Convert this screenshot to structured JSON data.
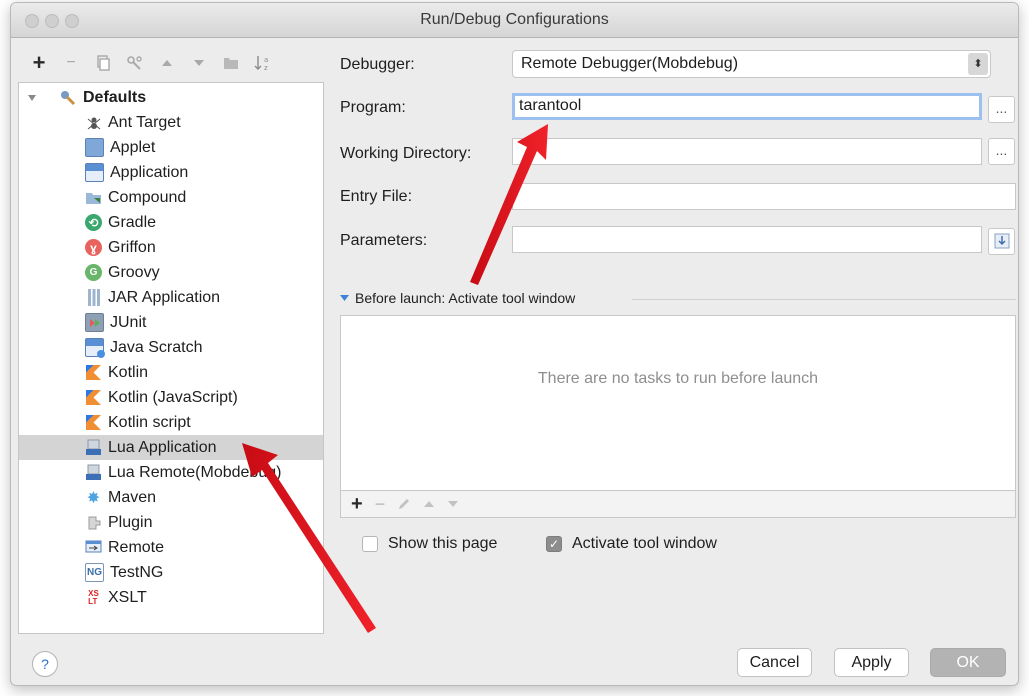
{
  "window": {
    "title": "Run/Debug Configurations"
  },
  "left_toolbar": {
    "icons": [
      "plus-icon",
      "minus-icon",
      "copy-icon",
      "wrench-icon",
      "arrow-up-icon",
      "arrow-down-icon",
      "folder-icon",
      "sort-icon"
    ],
    "add_glyph": "+",
    "remove_glyph": "−"
  },
  "tree": {
    "root_label": "Defaults",
    "items": [
      {
        "label": "Ant Target",
        "icon": "ant-icon"
      },
      {
        "label": "Applet",
        "icon": "applet-icon"
      },
      {
        "label": "Application",
        "icon": "application-icon"
      },
      {
        "label": "Compound",
        "icon": "compound-icon"
      },
      {
        "label": "Gradle",
        "icon": "gradle-icon"
      },
      {
        "label": "Griffon",
        "icon": "griffon-icon"
      },
      {
        "label": "Groovy",
        "icon": "groovy-icon"
      },
      {
        "label": "JAR Application",
        "icon": "jar-icon"
      },
      {
        "label": "JUnit",
        "icon": "junit-icon"
      },
      {
        "label": "Java Scratch",
        "icon": "java-scratch-icon"
      },
      {
        "label": "Kotlin",
        "icon": "kotlin-icon"
      },
      {
        "label": "Kotlin (JavaScript)",
        "icon": "kotlin-icon"
      },
      {
        "label": "Kotlin script",
        "icon": "kotlin-icon"
      },
      {
        "label": "Lua Application",
        "icon": "lua-icon",
        "selected": true
      },
      {
        "label": "Lua Remote(Mobdebug)",
        "icon": "lua-icon"
      },
      {
        "label": "Maven",
        "icon": "maven-icon"
      },
      {
        "label": "Plugin",
        "icon": "plugin-icon"
      },
      {
        "label": "Remote",
        "icon": "remote-icon"
      },
      {
        "label": "TestNG",
        "icon": "testng-icon"
      },
      {
        "label": "XSLT",
        "icon": "xslt-icon"
      }
    ]
  },
  "form": {
    "debugger_label": "Debugger:",
    "debugger_value": "Remote Debugger(Mobdebug)",
    "program_label": "Program:",
    "program_value": "tarantool",
    "working_dir_label": "Working Directory:",
    "working_dir_value": "",
    "entry_file_label": "Entry File:",
    "entry_file_value": "",
    "parameters_label": "Parameters:",
    "parameters_value": "",
    "browse_label": "..."
  },
  "before_launch": {
    "title": "Before launch: Activate tool window",
    "empty_text": "There are no tasks to run before launch",
    "add_glyph": "+",
    "remove_glyph": "−"
  },
  "options": {
    "show_page_label": "Show this page",
    "show_page_checked": false,
    "activate_window_label": "Activate tool window",
    "activate_window_checked": true
  },
  "buttons": {
    "help": "?",
    "cancel": "Cancel",
    "apply": "Apply",
    "ok": "OK"
  },
  "colors": {
    "selection": "#d4d4d4",
    "arrow": "#e8141c",
    "focus_ring": "#9cc0ef",
    "kotlin": "#f18e33",
    "ok_disabled": "#b3b3b3"
  }
}
